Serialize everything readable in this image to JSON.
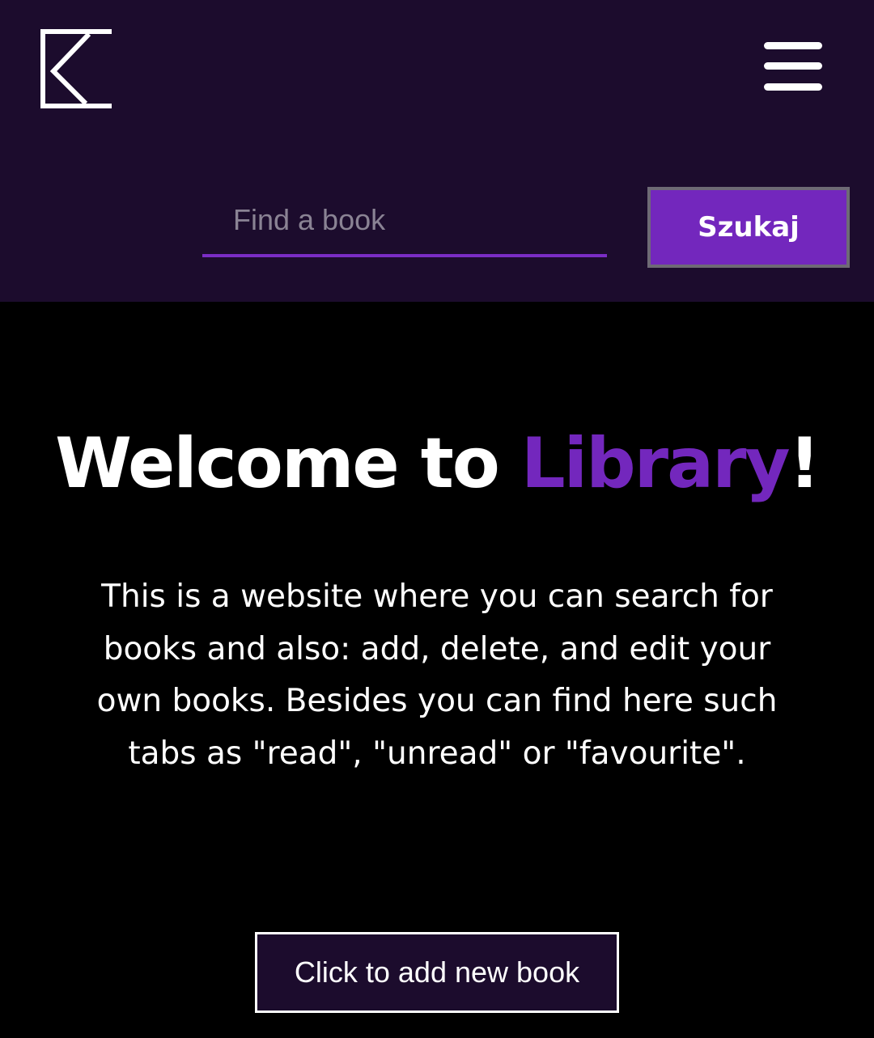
{
  "header": {
    "logo_icon": "k-logo-icon",
    "menu_icon": "hamburger-menu-icon",
    "search": {
      "placeholder": "Find a book",
      "value": "",
      "button_label": "Szukaj"
    }
  },
  "hero": {
    "title_prefix": "Welcome to ",
    "title_highlight": "Library",
    "title_suffix": "!",
    "description": "This is a website where you can search for books and also: add, delete, and edit your own books. Besides you can find here such tabs as \"read\", \"unread\" or \"favourite\".",
    "add_button_label": "Click to add new book"
  },
  "colors": {
    "header_bg": "#1c0c2d",
    "page_bg": "#000000",
    "accent": "#7327bd",
    "text": "#ffffff"
  }
}
